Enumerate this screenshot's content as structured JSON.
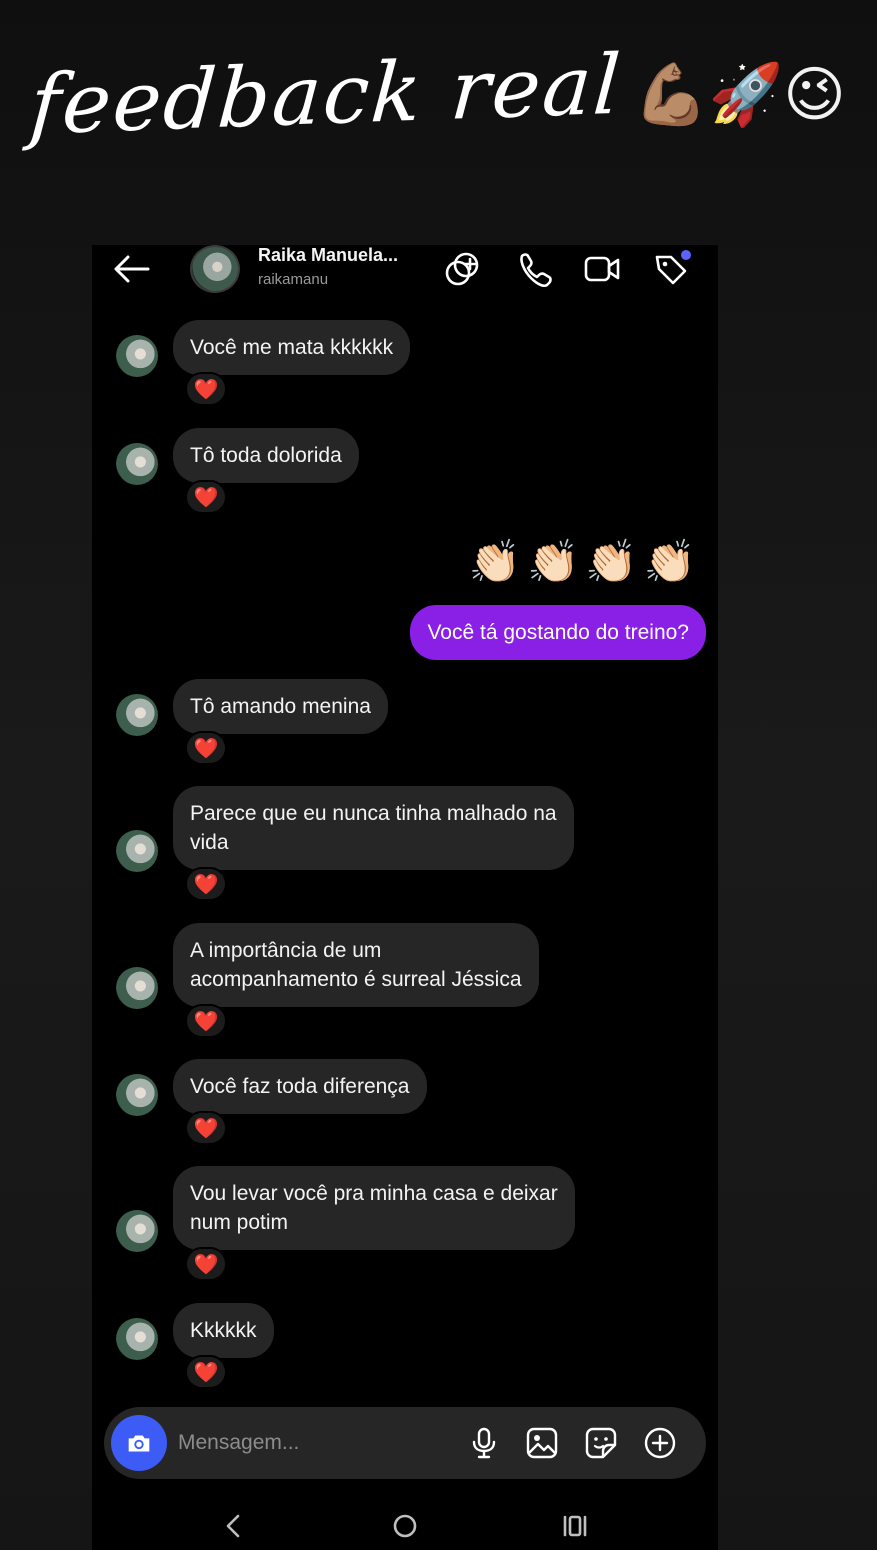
{
  "overlay": {
    "title": "feedback real",
    "emojis": "💪🏽🚀😉"
  },
  "header": {
    "contact_name": "Raika Manuela...",
    "username": "raikamanu",
    "icons": [
      "back-arrow-icon",
      "add-people-icon",
      "phone-icon",
      "video-icon",
      "tag-icon"
    ],
    "notification_dot_color": "#5b63ff"
  },
  "messages": [
    {
      "direction": "in",
      "text": "Você me mata kkkkkk",
      "reaction": "❤️"
    },
    {
      "direction": "in",
      "text": "Tô toda dolorida",
      "reaction": "❤️"
    },
    {
      "direction": "out",
      "text": "👏🏻👏🏻👏🏻👏🏻"
    },
    {
      "direction": "out",
      "text": "Você tá gostando do treino?"
    },
    {
      "direction": "in",
      "text": "Tô amando menina",
      "reaction": "❤️"
    },
    {
      "direction": "in",
      "text": "Parece que eu nunca tinha malhado na\nvida",
      "reaction": "❤️"
    },
    {
      "direction": "in",
      "text": "A importância de um\nacompanhamento é surreal Jéssica",
      "reaction": "❤️"
    },
    {
      "direction": "in",
      "text": "Você faz toda diferença",
      "reaction": "❤️"
    },
    {
      "direction": "in",
      "text": "Vou levar você pra minha casa e deixar\nnum potim",
      "reaction": "❤️"
    },
    {
      "direction": "in",
      "text": "Kkkkkk",
      "reaction": "❤️"
    }
  ],
  "composer": {
    "placeholder": "Mensagem...",
    "icons": [
      "camera-icon",
      "microphone-icon",
      "image-icon",
      "sticker-icon",
      "add-icon"
    ]
  },
  "colors": {
    "outgoing_bubble": "#8a1fe6",
    "incoming_bubble": "#262626",
    "camera_button": "#3d5cf6",
    "reaction_heart": "#e0223a"
  },
  "system_nav": {
    "icons": [
      "nav-back-icon",
      "nav-home-icon",
      "nav-recents-icon"
    ]
  }
}
